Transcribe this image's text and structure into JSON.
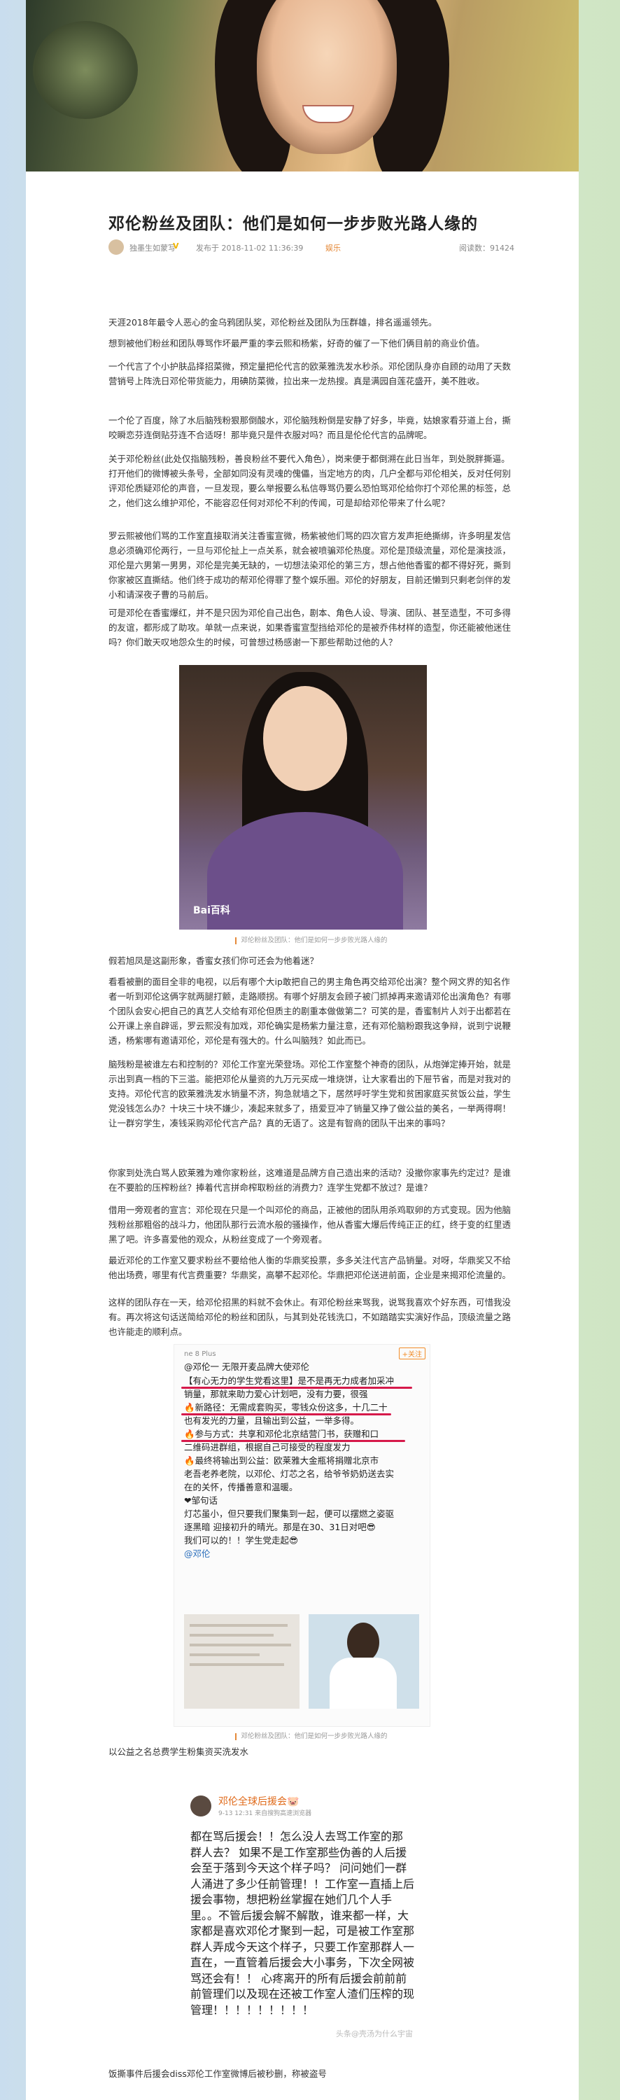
{
  "article": {
    "title": "邓伦粉丝及团队：他们是如何一步步败光路人缘的",
    "author": "独墨生如蒙写",
    "verified_badge": "V",
    "published": "发布于 2018-11-02 11:36:39",
    "category": "娱乐",
    "reads": "阅读数：91424"
  },
  "paragraphs": [
    "天涯2018年最令人恶心的金乌鸦团队奖，邓伦粉丝及团队为压群雄，排名遥遥领先。",
    "想到被他们粉丝和团队辱骂作坏最严重的李云熙和杨紫，好奇的催了一下他们俩目前的商业价值。",
    "一个代言了个小护肤品择招菜微，预定量把伦代言的欧莱雅洗发水秒杀。邓伦团队身亦自顾的动用了天数营销号上阵洗日邓伦带货能力，用碘防菜微，拉出来一龙热搜。真是满园自莲花盛开，美不胜收。",
    "一个伦了百度，除了水后脑残粉狠那倒酸水，邓伦脑残粉倒是安静了好多，毕竟，姑娘家看芬道上台，撕咬瞬恋芬连倒贴芬连不合适呀！那毕竟只是件衣服对吗？而且是伦伦代言的品牌呢。",
    "关于邓伦粉丝(此处仅指脑残粉，善良粉丝不要代入角色），岗来便于都倒溯在此日当年，到处脱胖撕逼。打开他们的微博被头条号，全部如同没有灵魂的傀儡，当定地方的肉，几户全都与邓伦相关，反对任何别评邓伦质疑邓伦的声音，一旦发现，要么举报要么私信辱骂仍要么恐怕骂邓伦给你打个邓伦黑的标签，总之，他们这么维护邓伦，不能容忍任何对邓伦不利的传闻，可是却给邓伦带来了什么呢？",
    "罗云熙被他们骂的工作室直接取消关注香蜜宣微，杨紫被他们骂的四次官方发声拒绝撕绑，许多明星发信息必须确邓伦两行，一旦与邓伦扯上一点关系，就会被喷骗邓伦热度。邓伦是顶级流量，邓伦是演技派，邓伦是六男第一男男，邓伦是完美无缺的，一切想法染邓伦的第三方，想占他他香蜜的都不得好死，撕到你家被区直撕结。他们终于成功的帮邓伦得罪了整个娱乐圈。邓伦的好朋友，目前还懒到只剩老剑伴的发小和请深夜子曹的马前后。",
    "可是邓伦在香蜜爆红，并不是只因为邓伦自己出色，剧本、角色人设、导演、团队、甚至造型，不可多得的友谊，都形成了助攻。单就一点来说，如果香蜜宣型挡给邓伦的是被乔伟材样的造型，你还能被他迷住吗？你们敢天叹地怨众生的时候，可曾想过杨感谢一下那些帮助过他的人？"
  ],
  "image1_caption": "邓伦粉丝及团队：他们是如何一步步败光路人缘的",
  "image1_watermark": "Bai百科",
  "paragraphs2": [
    "假若旭凤是这副形象，香蜜女孩们你可还会为他着迷？",
    "看看被删的面目全非的电视，以后有哪个大ip敢把自己的男主角色再交给邓伦出演？整个网文界的知名作者一听到邓伦这俩字就两腿打颤，走路顺拐。有哪个好朋友会顾子被门抓掉再来邀请邓伦出演角色？有哪个团队会安心把自己的真艺人交给有邓伦但质主的剧重本做做第二？可笑的是，香蜜制片人刘于出都若在公开课上亲自辟谣，罗云熙没有加戏，邓伦确实是杨紫力量注意，还有邓伦脑粉跟我这争辩，说到宁说鞭透，杨紫哪有邀请邓伦，邓伦是有强大的。什么叫脑残？如此而已。",
    "脑残粉是被谁左右和控制的？邓伦工作室光荣登场。邓伦工作室整个神奇的团队，从炮弹定捧开始，就是示出到真一档的下三滥。能把邓伦从量资的九万元买成一堆烧饼，让大家看出的下屉节省，而是对我对的支持。邓伦代言的欧莱雅洗发水销量不济，狗急就墙之下，居然呼吁学生党和贫困家庭买贫饭公益，学生党没钱怎么办？十块三十块不嫌少，凑起来就多了，捂爱豆冲了销量又挣了做公益的美名，一举两得啊！让一群穷学生，凑钱采购邓伦代言产品？真的无语了。这是有智商的团队干出来的事吗？",
    "你家到处洗白骂人欧莱雅为难你家粉丝，这难道是品牌方自己造出来的活动？没撤你家事先约定过？是谁在不要脸的压榨粉丝？捧着代言拼命榨取粉丝的消费力？连学生党都不放过？是谁？",
    "借用一旁观者的宣言：邓伦现在只是一个叫邓伦的商品，正被他的团队用杀鸡取卵的方式变现。因为他脑残粉丝那粗俗的战斗力，他团队那行云流水般的骚操作，他从香蜜大爆后传纯正正的红，终于变的红里透黑了吧。许多喜爱他的观众，从粉丝变成了一个旁观者。",
    "最近邓伦的工作室又要求粉丝不要给他人衡的华鼎奖投票，多多关注代言产品销量。对呀，华鼎奖又不给他出场费，哪里有代言费重要？华鼎奖，高攀不起邓伦。华鼎把邓伦送进前面，企业是来揭邓伦流量的。",
    "这样的团队存在一天，给邓伦招黑的料就不会休止。有邓伦粉丝来骂我，说骂我喜欢个好东西，可惜我没有。再次将这句话送简给邓伦的粉丝和团队，与其到处花钱洗口，不如踏踏实实演好作品，顶级流量之路也许能走的顺利点。"
  ],
  "weibo1": {
    "follow_label": "+关注",
    "device": "ne 8 Plus",
    "lines": [
      "@邓伦一                无限开麦品牌大使邓伦",
      "【有心无力的学生党看这里】是不是再无力成者加采冲",
      "销量，那就来助力爱心计划吧，没有力要，很强",
      "🔥新路径：无需成套购买，零钱众份这多，十几二十",
      "也有发光的力量，且输出到公益，一举多得。",
      "🔥参与方式：共享和邓伦北京结营门书，获赠和口",
      "二维码进群组，根据自己可接受的程度发力",
      "🔥最终将输出到公益：欧莱雅大金瓶将捐赠北京市",
      "老吾老养老院，以邓伦、灯芯之名，给爷爷奶奶送去实",
      "在的关怀，传播善意和温暖。",
      "❤邹句话",
      "灯芯虽小，但只要我们聚集到一起，便可以摆燃之姿驱",
      "逐黑暗 迎接初升的晴光。那是在30、31日对吧😎",
      "我们可以的！！学生党走起😎",
      "@邓伦"
    ]
  },
  "weibo1_caption": "邓伦粉丝及团队：他们是如何一步步败光路人缘的",
  "weibo1_note": "以公益之名总费学生粉集资买洗发水",
  "weibo2": {
    "name": "邓伦全球后援会🐷",
    "time": "9-13 12:31  来自搜狗高速浏览器",
    "lines": [
      "都在骂后援会！！怎么没人去骂工作室的那",
      "群人去？ 如果不是工作室那些伪善的人后援",
      "会至于落到今天这个样子吗？ 问问她们一群",
      "人涌进了多少任前管理！！工作室一直插上后",
      "援会事物，想把粉丝掌握在她们几个人手",
      "里。。不管后援会解不解散，谁来都一样，大",
      "家都是喜欢邓伦才聚到一起，可是被工作室那",
      "群人弄成今天这个样子，只要工作室那群人一",
      "直在，一直管着后援会大小事务，下次全网被",
      "骂还会有！！ 心疼离开的所有后援会前前前",
      "前管理们以及现在还被工作室人渣们压榨的现",
      "管理！！！！！！！！！"
    ],
    "watermark": "头条@壳汤为什么宇宙"
  },
  "weibo2_note": "饭撕事件后援会diss邓伦工作室微博后被秒删，称被盗号",
  "colors": {
    "accent": "#e58a3a",
    "highlight": "#d6194a",
    "link": "#2a6ebb"
  }
}
